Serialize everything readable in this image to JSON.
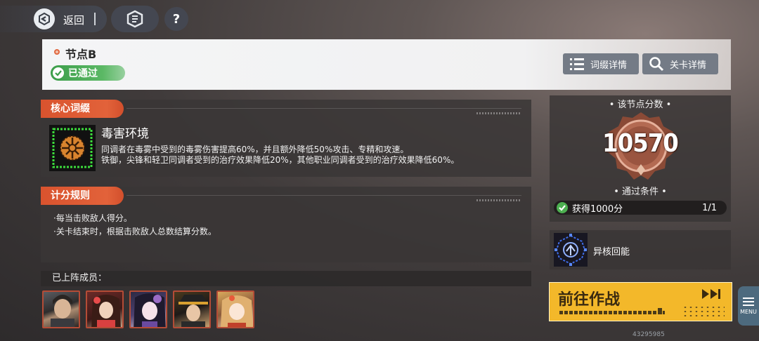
{
  "topbar": {
    "back_label": "返回",
    "help_label": "?"
  },
  "header": {
    "node_title": "节点B",
    "passed_label": "已通过",
    "affix_detail_label": "词缀详情",
    "stage_detail_label": "关卡详情"
  },
  "core_affix": {
    "tag": "核心词缀",
    "name": "毒害环境",
    "desc_line1": "同调者在毒雾中受到的毒雾伤害提高60%，并且额外降低50%攻击、专精和攻速。",
    "desc_line2": "铁御，尖锋和轻卫同调者受到的治疗效果降低20%，其他职业同调者受到的治疗效果降低60%。"
  },
  "score_rules": {
    "tag": "计分规则",
    "rule1": "·每当击败敌人得分。",
    "rule2": "·关卡结束时，根据击败敌人总数结算分数。"
  },
  "members": {
    "label": "已上阵成员：",
    "portraits": [
      "member-1",
      "member-2",
      "member-3",
      "member-4",
      "member-5"
    ]
  },
  "node_score": {
    "title": "• 该节点分数 •",
    "score": "10570",
    "condition_title": "• 通过条件 •",
    "condition_text": "获得1000分",
    "condition_count": "1/1"
  },
  "buff": {
    "name": "异核回能"
  },
  "go_button": {
    "label": "前往作战"
  },
  "menu_label": "MENU",
  "uid": "43295985",
  "colors": {
    "accent_orange": "#e2623a",
    "pass_green": "#4caf50",
    "go_yellow": "#f3b82a"
  }
}
